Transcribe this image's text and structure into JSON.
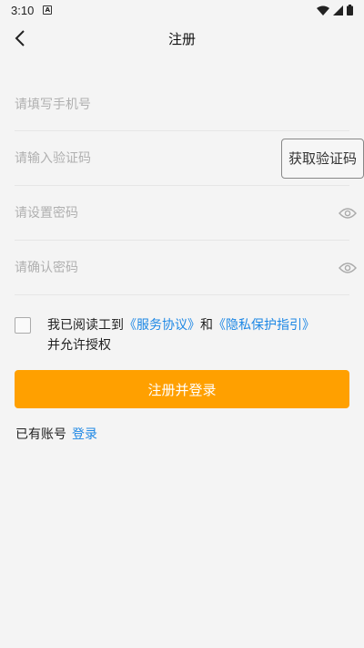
{
  "status_bar": {
    "time": "3:10",
    "notif_letter": "A"
  },
  "header": {
    "title": "注册"
  },
  "form": {
    "phone_placeholder": "请填写手机号",
    "code_placeholder": "请输入验证码",
    "code_button": "获取验证码",
    "password_placeholder": "请设置密码",
    "confirm_placeholder": "请确认密码"
  },
  "agreement": {
    "prefix": "我已阅读工到",
    "service_link": "《服务协议》",
    "conjunction": "和",
    "privacy_link": "《隐私保护指引》",
    "suffix": "并允许授权"
  },
  "submit_label": "注册并登录",
  "login_prompt": {
    "text": "已有账号",
    "link": "登录"
  },
  "colors": {
    "accent": "#ffa000",
    "link": "#1e88e5",
    "background": "#f4f4f4"
  }
}
